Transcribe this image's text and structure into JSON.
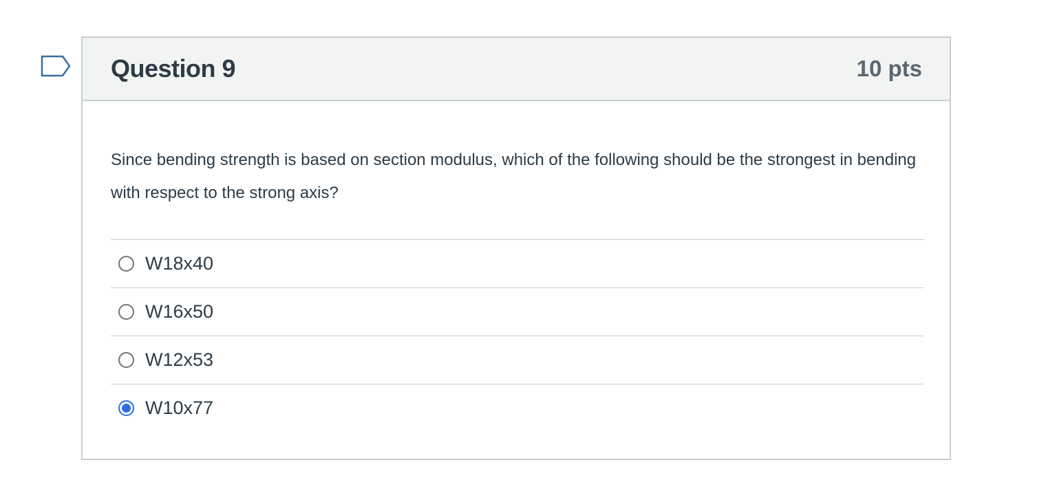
{
  "question": {
    "title": "Question 9",
    "points": "10 pts",
    "text": "Since bending strength is based on section modulus, which of the following should be the strongest in bending with respect to the strong axis?",
    "answers": [
      {
        "label": "W18x40",
        "selected": false
      },
      {
        "label": "W16x50",
        "selected": false
      },
      {
        "label": "W12x53",
        "selected": false
      },
      {
        "label": "W10x77",
        "selected": true
      }
    ]
  },
  "colors": {
    "header_bg": "#f2f4f4",
    "border": "#c7cdd1",
    "text": "#2d3b45",
    "accent": "#2d6ce7"
  },
  "icons": {
    "flag": "flag-bookmark-icon"
  }
}
